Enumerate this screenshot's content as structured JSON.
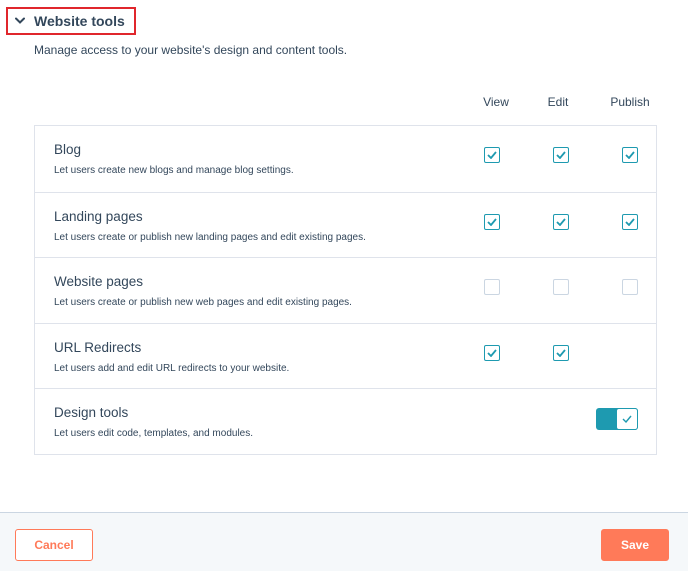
{
  "section": {
    "title": "Website tools",
    "description": "Manage access to your website's design and content tools.",
    "chevron_icon": "chevron-down-icon"
  },
  "columns": {
    "view": "View",
    "edit": "Edit",
    "publish": "Publish"
  },
  "rows": [
    {
      "title": "Blog",
      "description": "Let users create new blogs and manage blog settings.",
      "view": true,
      "edit": true,
      "publish": true
    },
    {
      "title": "Landing pages",
      "description": "Let users create or publish new landing pages and edit existing pages.",
      "view": true,
      "edit": true,
      "publish": true
    },
    {
      "title": "Website pages",
      "description": "Let users create or publish new web pages and edit existing pages.",
      "view": false,
      "edit": false,
      "publish": false
    },
    {
      "title": "URL Redirects",
      "description": "Let users add and edit URL redirects to your website.",
      "view": true,
      "edit": true
    },
    {
      "title": "Design tools",
      "description": "Let users edit code, templates, and modules.",
      "toggle_on": true
    }
  ],
  "footer": {
    "cancel_label": "Cancel",
    "save_label": "Save"
  },
  "colors": {
    "accent": "#1e9ab0",
    "primary_button": "#ff7a59",
    "highlight_border": "#e0262c",
    "text": "#33475b"
  }
}
